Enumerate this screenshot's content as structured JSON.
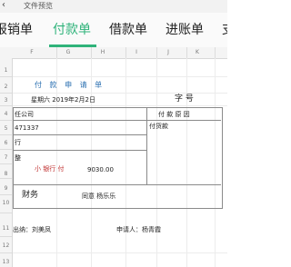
{
  "titlebar": {
    "title": "文件预览"
  },
  "tabs": [
    {
      "label": "报销单"
    },
    {
      "label": "付款单"
    },
    {
      "label": "借款单"
    },
    {
      "label": "进账单"
    },
    {
      "label": "支"
    }
  ],
  "columns": [
    "F",
    "G",
    "H",
    "I",
    "J",
    "K"
  ],
  "rows": [
    "1",
    "2",
    "3",
    "4",
    "5",
    "6",
    "7",
    "8",
    "9",
    "10",
    "11",
    "12",
    "13"
  ],
  "form": {
    "title": "付 款 申 请 单",
    "date": "星期六 2019年2月2日",
    "number_label": "字  号",
    "company": "任公司",
    "account": "471337",
    "bank": "行",
    "amount_note": "整",
    "purpose_header": "付 款 原 因",
    "purpose_value": "付货款",
    "amount_caps_label": "小  银行 付  ",
    "amount_value": "9030.00",
    "finance_label": "财务",
    "agree_text": "同意  杨乐乐",
    "cashier": "出纳：刘美凤",
    "applicant": "申请人：杨青霞"
  }
}
